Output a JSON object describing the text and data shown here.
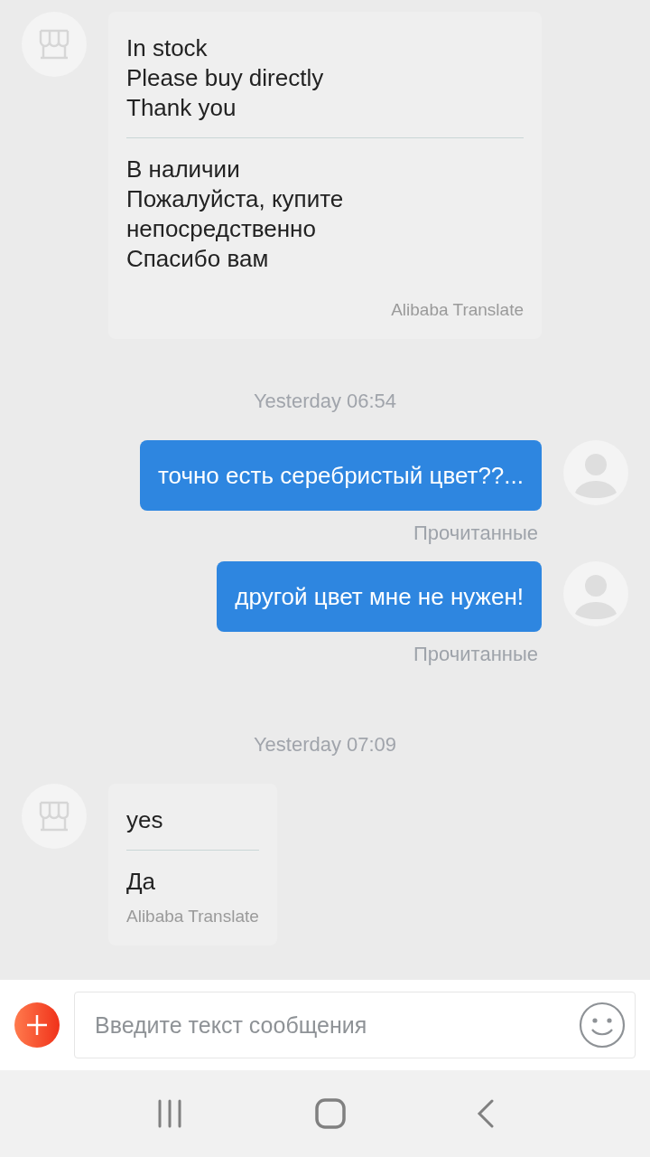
{
  "messages": [
    {
      "kind": "incoming",
      "original": "In stock\nPlease buy directly\nThank you",
      "translation": "В наличии\nПожалуйста, купите непосредственно\nСпасибо вам",
      "attribution": "Alibaba Translate"
    },
    {
      "kind": "timestamp",
      "text": "Yesterday 06:54"
    },
    {
      "kind": "outgoing",
      "text": "точно есть серебристый цвет??...",
      "status": "Прочитанные"
    },
    {
      "kind": "outgoing",
      "text": "другой цвет мне не нужен!",
      "status": "Прочитанные"
    },
    {
      "kind": "timestamp",
      "text": "Yesterday 07:09"
    },
    {
      "kind": "incoming",
      "original": "yes",
      "translation": "Да",
      "attribution": "Alibaba Translate"
    }
  ],
  "composer": {
    "placeholder": "Введите текст сообщения"
  }
}
